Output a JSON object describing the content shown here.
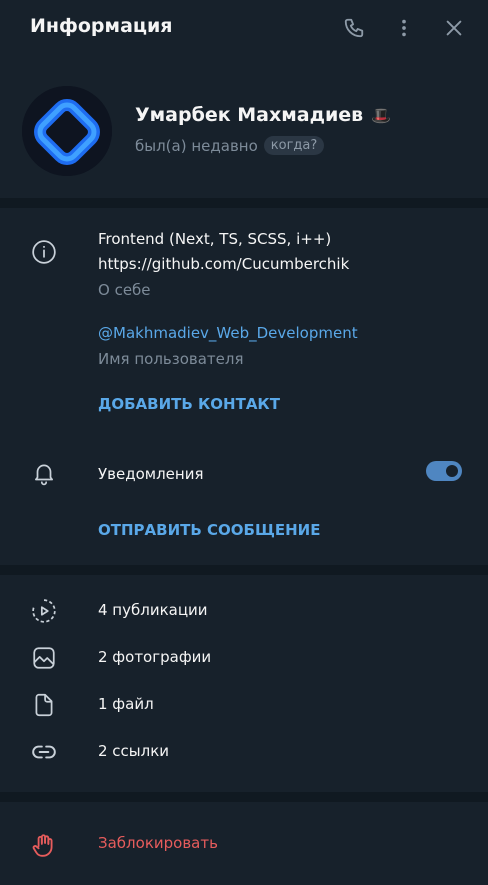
{
  "header": {
    "title": "Информация",
    "icons": [
      "phone-icon",
      "more-vertical-icon",
      "close-icon"
    ]
  },
  "profile": {
    "name": "Умарбек Махмадиев",
    "name_badge": "🎩",
    "status": "был(а) недавно",
    "when_label": "когда?"
  },
  "info": {
    "bio": "Frontend (Next, TS, SCSS, i++)",
    "bio_link": "https://github.com/Cucumberchik",
    "bio_caption": "О себе",
    "username": "@Makhmadiev_Web_Development",
    "username_caption": "Имя пользователя",
    "add_contact": "ДОБАВИТЬ КОНТАКТ"
  },
  "notifications": {
    "label": "Уведомления",
    "enabled": true,
    "send_message": "ОТПРАВИТЬ СООБЩЕНИЕ"
  },
  "media": [
    {
      "label": "4 публикации",
      "icon": "stories-icon"
    },
    {
      "label": "2 фотографии",
      "icon": "photo-icon"
    },
    {
      "label": "1 файл",
      "icon": "file-icon"
    },
    {
      "label": "2 ссылки",
      "icon": "link-icon"
    }
  ],
  "block": {
    "label": "Заблокировать",
    "icon": "stop-hand-icon"
  },
  "colors": {
    "background": "#17212b",
    "accent": "#5aa8e8",
    "danger": "#e65c5c",
    "muted": "#7d8b99"
  }
}
